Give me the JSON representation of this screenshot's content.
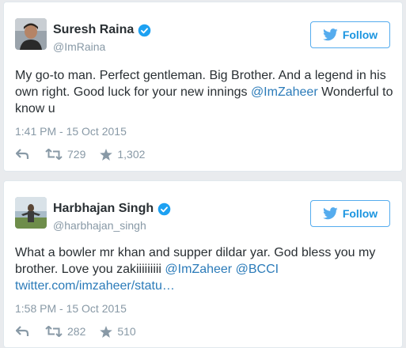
{
  "tweets": [
    {
      "name": "Suresh Raina",
      "handle": "@ImRaina",
      "follow_label": "Follow",
      "text_parts": [
        "My go-to man. Perfect gentleman. Big Brother. And a legend in his own right. Good luck for your new innings ",
        "@ImZaheer",
        " Wonderful to know u"
      ],
      "timestamp": "1:41 PM - 15 Oct 2015",
      "retweets": "729",
      "likes": "1,302"
    },
    {
      "name": "Harbhajan Singh",
      "handle": "@harbhajan_singh",
      "follow_label": "Follow",
      "text_parts": [
        "What a bowler mr khan and supper dildar yar. God bless you my brother. Love you zakiiiiiiiii ",
        "@ImZaheer",
        "  ",
        "@BCCI",
        " ",
        "twitter.com/imzaheer/statu…"
      ],
      "timestamp": "1:58 PM - 15 Oct 2015",
      "retweets": "282",
      "likes": "510"
    }
  ],
  "colors": {
    "accent": "#1b95e0",
    "link": "#2b7bb9",
    "muted": "#8899a6",
    "verified": "#1da1f2"
  },
  "icons": {
    "verified": "verified-badge-icon",
    "follow": "twitter-bird-icon",
    "reply": "reply-icon",
    "retweet": "retweet-icon",
    "like": "star-icon"
  }
}
